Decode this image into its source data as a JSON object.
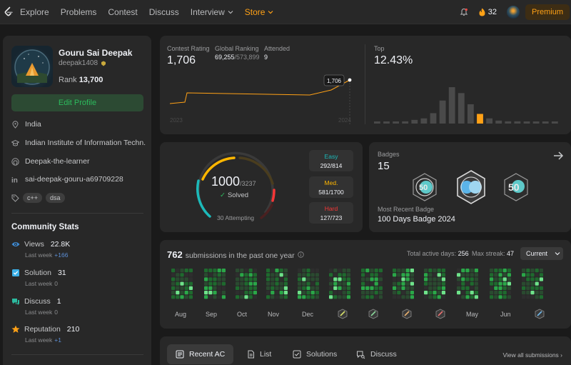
{
  "nav": {
    "items": [
      "Explore",
      "Problems",
      "Contest",
      "Discuss",
      "Interview",
      "Store"
    ],
    "streak_count": "32",
    "premium_label": "Premium"
  },
  "profile": {
    "name": "Gouru Sai Deepak",
    "handle": "deepak1408",
    "rank_label": "Rank",
    "rank_value": "13,700",
    "edit_label": "Edit Profile",
    "location": "India",
    "school": "Indian Institute of Information Techn...",
    "github": "Deepak-the-learner",
    "linkedin": "sai-deepak-gouru-a69709228",
    "skills": [
      "c++",
      "dsa"
    ]
  },
  "community": {
    "title": "Community Stats",
    "stats": [
      {
        "label": "Views",
        "value": "22.8K",
        "sub_label": "Last week",
        "sub_value": "+166",
        "color": "#3e8cd6"
      },
      {
        "label": "Solution",
        "value": "31",
        "sub_label": "Last week",
        "sub_value": "0",
        "color": "#3bb0e8"
      },
      {
        "label": "Discuss",
        "value": "1",
        "sub_label": "Last week",
        "sub_value": "0",
        "color": "#2cbba0"
      },
      {
        "label": "Reputation",
        "value": "210",
        "sub_label": "Last week",
        "sub_value": "+1",
        "color": "#ffa116"
      }
    ]
  },
  "contest": {
    "rating_label": "Contest Rating",
    "rating": "1,706",
    "global_label": "Global Ranking",
    "global_rank": "69,255",
    "global_total": "/573,899",
    "attended_label": "Attended",
    "attended": "9",
    "tooltip": "1,706",
    "x_start": "2023",
    "x_end": "2024",
    "top_label": "Top",
    "top_value": "12.43%",
    "histogram": [
      0.05,
      0.05,
      0.05,
      0.06,
      0.1,
      0.14,
      0.28,
      0.62,
      0.98,
      0.82,
      0.52,
      0.26,
      0.14,
      0.08,
      0.06,
      0.06,
      0.05,
      0.05,
      0.05,
      0.05
    ],
    "highlight_index": 11,
    "accent_color": "#ffa116"
  },
  "solved": {
    "count": "1000",
    "total": "/3237",
    "solved_label": "Solved",
    "attempting": "30 Attempting",
    "difficulties": [
      {
        "label": "Easy",
        "value": "292/814",
        "color": "#1cbaba"
      },
      {
        "label": "Med.",
        "value": "581/1700",
        "color": "#ffb700"
      },
      {
        "label": "Hard",
        "value": "127/723",
        "color": "#f63737"
      }
    ]
  },
  "badges": {
    "title": "Badges",
    "count": "15",
    "recent_label": "Most Recent Badge",
    "recent_name": "100 Days Badge 2024",
    "badge_texts": [
      "50",
      "50"
    ]
  },
  "heatmap": {
    "count": "762",
    "suffix": "submissions in the past one year",
    "active_label": "Total active days:",
    "active_value": "256",
    "streak_label": "Max streak:",
    "streak_value": "47",
    "dropdown": "Current",
    "months": [
      "Aug",
      "Sep",
      "Oct",
      "Nov",
      "Dec",
      "May",
      "Jun"
    ]
  },
  "tabs": {
    "items": [
      "Recent AC",
      "List",
      "Solutions",
      "Discuss"
    ],
    "view_all": "View all submissions"
  }
}
